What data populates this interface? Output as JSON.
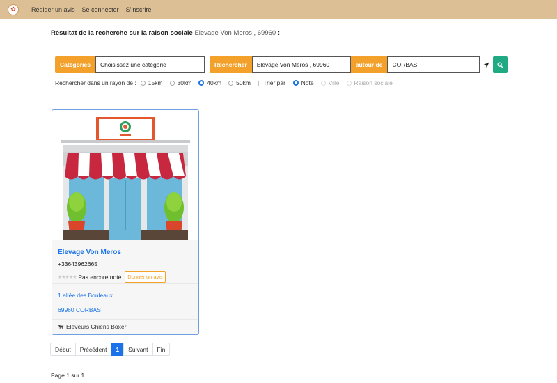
{
  "nav": {
    "items": [
      "Rédiger un avis",
      "Se connecter",
      "S'inscrire"
    ]
  },
  "result": {
    "title": "Résultat de la recherche sur la raison sociale",
    "query": "Elevage Von Meros , 69960",
    "colon": ":"
  },
  "search": {
    "categories_label": "Catégories",
    "categories_value": "Choisissez une catégorie",
    "search_label": "Rechercher",
    "search_value": "Elevage Von Meros , 69960",
    "around_label": "autour de",
    "around_value": "CORBAS"
  },
  "options": {
    "radius_label": "Rechercher dans un rayon de :",
    "radius": [
      "15km",
      "30km",
      "40km",
      "50km"
    ],
    "radius_selected": "40km",
    "separator": "|",
    "sort_label": "Trier par :",
    "sort": [
      "Note",
      "Ville",
      "Raison sociale"
    ],
    "sort_selected": "Note"
  },
  "card": {
    "name": "Elevage Von Meros",
    "phone": "+33643962665",
    "rating_text": "Pas encore noté",
    "rating_value": 0,
    "rating_max": 5,
    "review_button": "Donner un avis",
    "address_line": "1 allée des Bouleaux",
    "city_line": "69960 CORBAS",
    "category": "Eleveurs Chiens Boxer"
  },
  "pagination": {
    "first": "Début",
    "prev": "Précédent",
    "current": "1",
    "next": "Suivant",
    "last": "Fin"
  },
  "page_info": "Page 1 sur 1",
  "colors": {
    "topbar": "#dcbf95",
    "accent_orange": "#f3a12b",
    "link_blue": "#1a73e8",
    "search_button": "#1faa84"
  }
}
